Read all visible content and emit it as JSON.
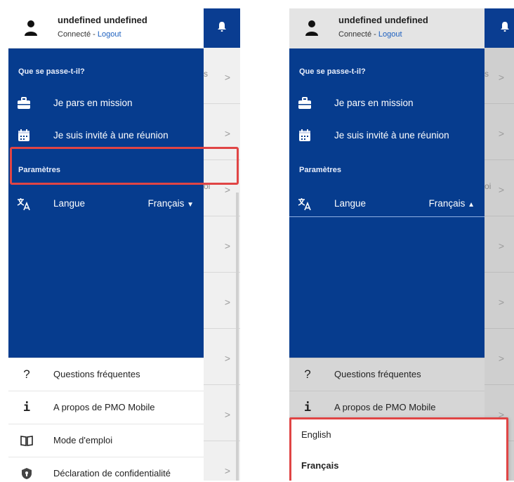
{
  "user": {
    "name": "undefined undefined",
    "status": "Connecté",
    "separator": " - ",
    "logout": "Logout"
  },
  "sections": {
    "events": "Que se passe-t-il?",
    "settings": "Paramètres"
  },
  "items": {
    "mission": "Je pars en mission",
    "meeting": "Je suis invité à une réunion"
  },
  "language": {
    "label": "Langue",
    "value": "Français"
  },
  "bottom": {
    "faq": "Questions fréquentes",
    "about": "A propos de PMO Mobile",
    "manual": "Mode d'emploi",
    "privacy": "Déclaration de confidentialité"
  },
  "background_fragments": {
    "row1": "s",
    "row3": "oi"
  },
  "language_options": [
    "English",
    "Français"
  ],
  "colors": {
    "drawer_blue": "#063c8e",
    "header_blue": "#0a3d91",
    "highlight_red": "#e04545",
    "link_blue": "#1b5fbf"
  }
}
